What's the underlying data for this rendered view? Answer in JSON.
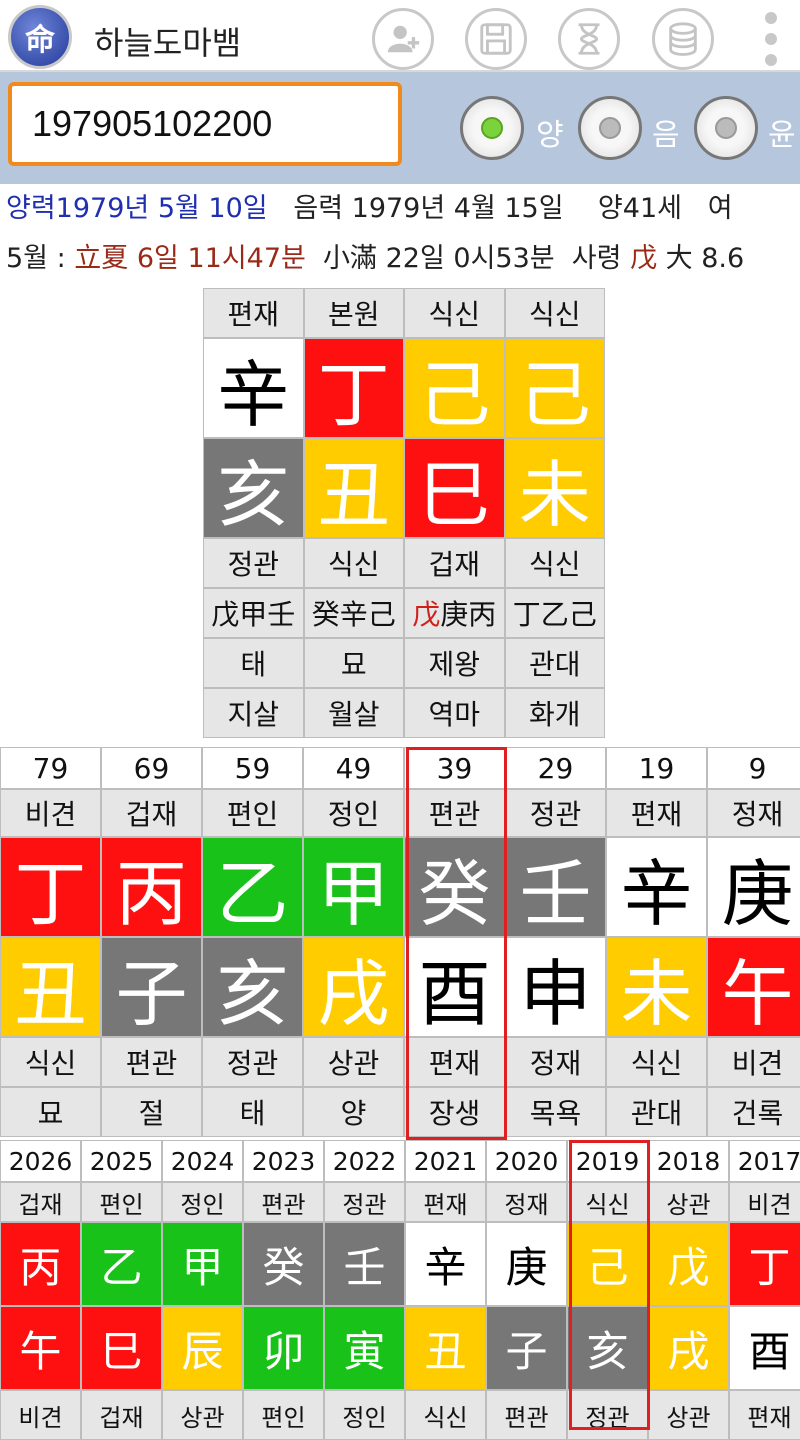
{
  "app": {
    "icon_char": "命",
    "title": "하늘도마뱀"
  },
  "input": {
    "value": "197905102200"
  },
  "calendar": [
    {
      "label": "양",
      "checked": true
    },
    {
      "label": "음",
      "checked": false
    },
    {
      "label": "윤",
      "checked": false
    }
  ],
  "info": {
    "solar": "양력1979년 5월 10일",
    "lunar": "음력 1979년 4월 15일",
    "age": "양41세",
    "gender": "여",
    "month_prefix": "5월 : ",
    "term1": "立夏 6일 11시47분",
    "term2": "小滿 22일 0시53분",
    "saryeong_label": "사령",
    "saryeong_char": "戊",
    "saryeong_rest": "大 8.6"
  },
  "natal": {
    "top_labels": [
      "편재",
      "본원",
      "식신",
      "식신"
    ],
    "stems": [
      {
        "ch": "辛",
        "color": "white"
      },
      {
        "ch": "丁",
        "color": "red"
      },
      {
        "ch": "己",
        "color": "yellow"
      },
      {
        "ch": "己",
        "color": "yellow"
      }
    ],
    "branches": [
      {
        "ch": "亥",
        "color": "gray"
      },
      {
        "ch": "丑",
        "color": "yellow"
      },
      {
        "ch": "巳",
        "color": "red"
      },
      {
        "ch": "未",
        "color": "yellow"
      }
    ],
    "branch_labels": [
      "정관",
      "식신",
      "겁재",
      "식신"
    ],
    "hidden": [
      {
        "first": "戊",
        "rest": "甲壬",
        "first_red": false
      },
      {
        "first": "癸",
        "rest": "辛己",
        "first_red": false
      },
      {
        "first": "戊",
        "rest": "庚丙",
        "first_red": true
      },
      {
        "first": "丁",
        "rest": "乙己",
        "first_red": false
      }
    ],
    "stage": [
      "태",
      "묘",
      "제왕",
      "관대"
    ],
    "sal": [
      "지살",
      "월살",
      "역마",
      "화개"
    ]
  },
  "daewoon": {
    "ages": [
      "79",
      "69",
      "59",
      "49",
      "39",
      "29",
      "19",
      "9"
    ],
    "stem_labels": [
      "비견",
      "겁재",
      "편인",
      "정인",
      "편관",
      "정관",
      "편재",
      "정재"
    ],
    "stems": [
      {
        "ch": "丁",
        "color": "red"
      },
      {
        "ch": "丙",
        "color": "red"
      },
      {
        "ch": "乙",
        "color": "green"
      },
      {
        "ch": "甲",
        "color": "green"
      },
      {
        "ch": "癸",
        "color": "gray"
      },
      {
        "ch": "壬",
        "color": "gray"
      },
      {
        "ch": "辛",
        "color": "white"
      },
      {
        "ch": "庚",
        "color": "white"
      }
    ],
    "branches": [
      {
        "ch": "丑",
        "color": "yellow"
      },
      {
        "ch": "子",
        "color": "gray"
      },
      {
        "ch": "亥",
        "color": "gray"
      },
      {
        "ch": "戌",
        "color": "yellow"
      },
      {
        "ch": "酉",
        "color": "white"
      },
      {
        "ch": "申",
        "color": "white"
      },
      {
        "ch": "未",
        "color": "yellow"
      },
      {
        "ch": "午",
        "color": "red"
      }
    ],
    "branch_labels": [
      "식신",
      "편관",
      "정관",
      "상관",
      "편재",
      "정재",
      "식신",
      "비견"
    ],
    "stage": [
      "묘",
      "절",
      "태",
      "양",
      "장생",
      "목욕",
      "관대",
      "건록"
    ],
    "selected_age": "39"
  },
  "yearly": {
    "years": [
      "2026",
      "2025",
      "2024",
      "2023",
      "2022",
      "2021",
      "2020",
      "2019",
      "2018",
      "2017"
    ],
    "stem_labels": [
      "겁재",
      "편인",
      "정인",
      "편관",
      "정관",
      "편재",
      "정재",
      "식신",
      "상관",
      "비견"
    ],
    "stems": [
      {
        "ch": "丙",
        "color": "red"
      },
      {
        "ch": "乙",
        "color": "green"
      },
      {
        "ch": "甲",
        "color": "green"
      },
      {
        "ch": "癸",
        "color": "gray"
      },
      {
        "ch": "壬",
        "color": "gray"
      },
      {
        "ch": "辛",
        "color": "white"
      },
      {
        "ch": "庚",
        "color": "white"
      },
      {
        "ch": "己",
        "color": "yellow"
      },
      {
        "ch": "戊",
        "color": "yellow"
      },
      {
        "ch": "丁",
        "color": "red"
      }
    ],
    "branches": [
      {
        "ch": "午",
        "color": "red"
      },
      {
        "ch": "巳",
        "color": "red"
      },
      {
        "ch": "辰",
        "color": "yellow"
      },
      {
        "ch": "卯",
        "color": "green"
      },
      {
        "ch": "寅",
        "color": "green"
      },
      {
        "ch": "丑",
        "color": "yellow"
      },
      {
        "ch": "子",
        "color": "gray"
      },
      {
        "ch": "亥",
        "color": "gray"
      },
      {
        "ch": "戌",
        "color": "yellow"
      },
      {
        "ch": "酉",
        "color": "white"
      }
    ],
    "branch_labels": [
      "비견",
      "겁재",
      "상관",
      "편인",
      "정인",
      "식신",
      "편관",
      "정관",
      "상관",
      "편재"
    ],
    "selected_year": "2019"
  },
  "colors": {
    "red": "#ff1010",
    "yellow": "#ffcc00",
    "gray": "#777777",
    "green": "#19c219",
    "white": "#ffffff",
    "accent_orange": "#f08a1c",
    "header_blue": "#b6c6dc",
    "highlight_red": "#e02020"
  },
  "icons": [
    "add-contact-icon",
    "save-icon",
    "hourglass-icon",
    "database-icon",
    "more-vertical-icon"
  ]
}
